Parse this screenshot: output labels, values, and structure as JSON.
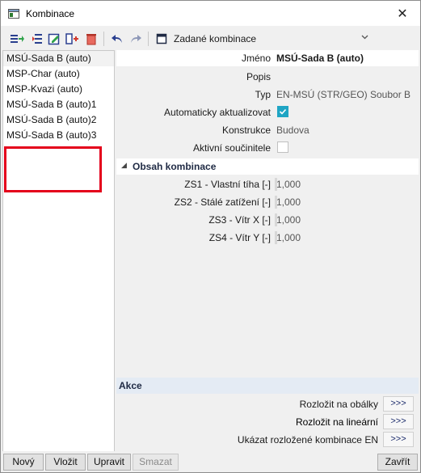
{
  "window": {
    "title": "Kombinace",
    "close_glyph": "✕"
  },
  "toolbar": {
    "icons": [
      "insert-icon",
      "insert-before-icon",
      "edit-icon",
      "copy-icon",
      "delete-icon",
      "undo-icon",
      "redo-icon",
      "table-view-icon"
    ],
    "combo_value": "Zadané kombinace"
  },
  "list": {
    "items": [
      "MSÚ-Sada B (auto)",
      "MSP-Char (auto)",
      "MSP-Kvazi (auto)",
      "MSÚ-Sada B (auto)1",
      "MSÚ-Sada B (auto)2",
      "MSÚ-Sada B (auto)3"
    ],
    "selected_index": 0,
    "highlight_color": "#e4001b"
  },
  "properties": {
    "name_label": "Jméno",
    "name_value": "MSÚ-Sada B (auto)",
    "desc_label": "Popis",
    "desc_value": "",
    "type_label": "Typ",
    "type_value": "EN-MSÚ (STR/GEO) Soubor B",
    "auto_update_label": "Automaticky aktualizovat",
    "auto_update_checked": true,
    "construction_label": "Konstrukce",
    "construction_value": "Budova",
    "active_coef_label": "Aktivní součinitele",
    "active_coef_checked": false
  },
  "content": {
    "header": "Obsah kombinace",
    "rows": [
      {
        "label": "ZS1 - Vlastní tíha [-]",
        "value": "1,000"
      },
      {
        "label": "ZS2 - Stálé zatížení [-]",
        "value": "1,000"
      },
      {
        "label": "ZS3 - Vítr X [-]",
        "value": "1,000"
      },
      {
        "label": "ZS4 - Vítr Y [-]",
        "value": "1,000"
      }
    ]
  },
  "actions": {
    "header": "Akce",
    "rows": [
      {
        "label": "Rozložit na obálky",
        "button": ">>>"
      },
      {
        "label": "Rozložit na lineární",
        "button": ">>>"
      },
      {
        "label": "Ukázat rozložené kombinace EN",
        "button": ">>>"
      }
    ]
  },
  "buttons": {
    "new": "Nový",
    "insert": "Vložit",
    "edit": "Upravit",
    "delete": "Smazat",
    "close": "Zavřít"
  },
  "colors": {
    "accent": "#1fa5c4",
    "section_header": "#1f2a44",
    "akce_bg": "#e4ebf4"
  }
}
